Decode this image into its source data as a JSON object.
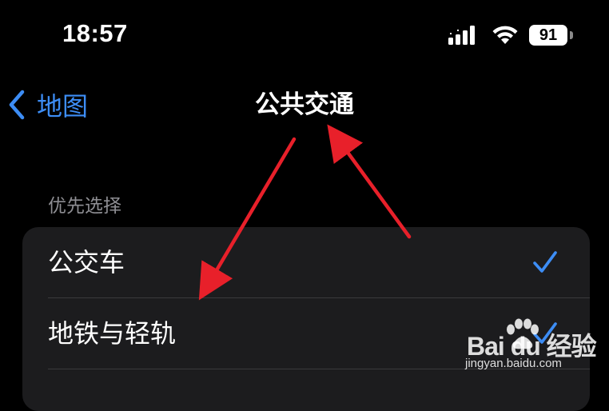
{
  "status_bar": {
    "time": "18:57",
    "battery_level": "91",
    "icons": [
      "signal-icon",
      "wifi-icon",
      "battery-icon"
    ]
  },
  "nav": {
    "back_label": "地图",
    "back_icon": "chevron-left-icon",
    "title": "公共交通"
  },
  "section": {
    "header": "优先选择"
  },
  "options": [
    {
      "label": "公交车",
      "checked": true
    },
    {
      "label": "地铁与轻轨",
      "checked": true
    }
  ],
  "watermark": {
    "logo_text": "Bai du 经验",
    "url": "jingyan.baidu.com"
  },
  "colors": {
    "accent": "#3d8df5",
    "annotation_arrow": "#e8202a",
    "background": "#000000",
    "card": "#1c1c1e",
    "secondary_text": "#8e8e93"
  }
}
